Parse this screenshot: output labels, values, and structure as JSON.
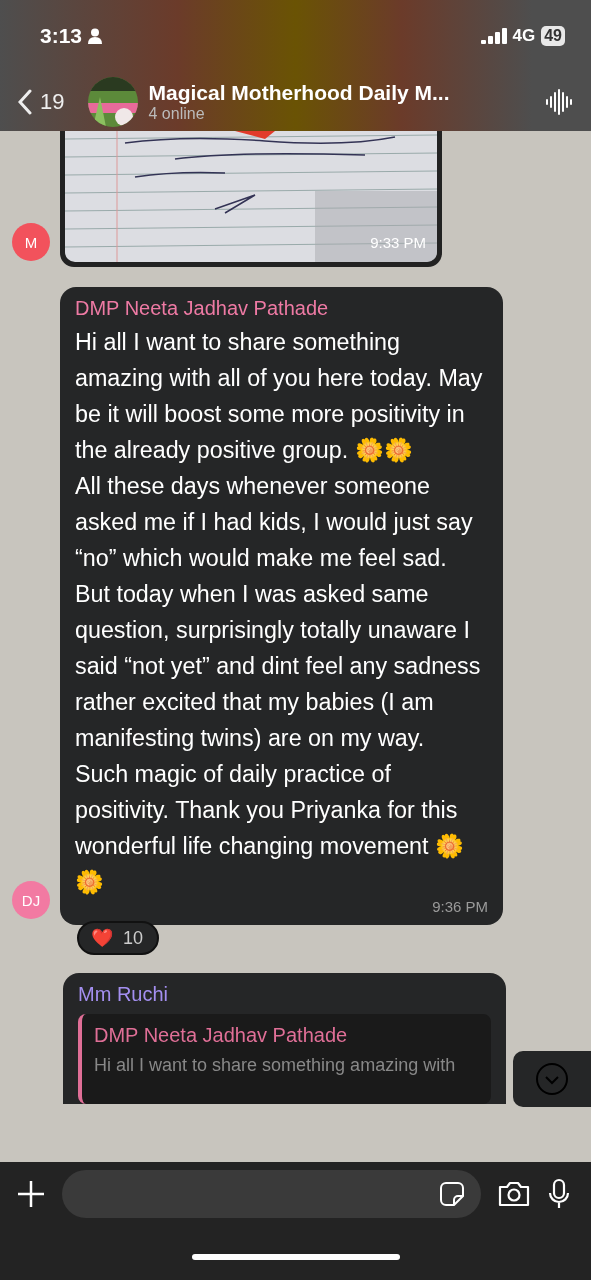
{
  "status_bar": {
    "time": "3:13",
    "network": "4G",
    "battery": "49"
  },
  "header": {
    "back_count": "19",
    "title": "Magical Motherhood Daily M...",
    "subtitle": "4 online"
  },
  "messages": [
    {
      "kind": "picture",
      "avatar": {
        "initials": "M",
        "color": "#f2525c"
      },
      "time": "9:33 PM"
    },
    {
      "kind": "text",
      "avatar": {
        "initials": "DJ",
        "color": "#f27aa2"
      },
      "sender": {
        "name": "DMP Neeta Jadhav Pathade",
        "color": "#ee7aa4"
      },
      "paragraphs": [
        "Hi all I want to share something amazing with all of you here today. May be it will boost some more positivity in the already positive group. 🌼🌼",
        "All these days whenever someone asked me if I had kids, I would just say “no” which would make me feel sad.",
        "But today when I was asked same question, surprisingly totally unaware I said “not yet” and dint feel any sadness rather excited that my babies (I am manifesting twins) are on my way.",
        "Such magic of daily practice of positivity. Thank you Priyanka for this wonderful life changing movement 🌼🌼"
      ],
      "time": "9:36 PM",
      "reaction": {
        "emoji": "❤️",
        "count": "10"
      }
    },
    {
      "kind": "reply",
      "sender": {
        "name": "Mm Ruchi",
        "color": "#a48ff0"
      },
      "quote": {
        "sender": {
          "name": "DMP Neeta Jadhav Pathade",
          "color": "#e06f97"
        },
        "text": "Hi all I want to share something amazing with"
      }
    }
  ]
}
